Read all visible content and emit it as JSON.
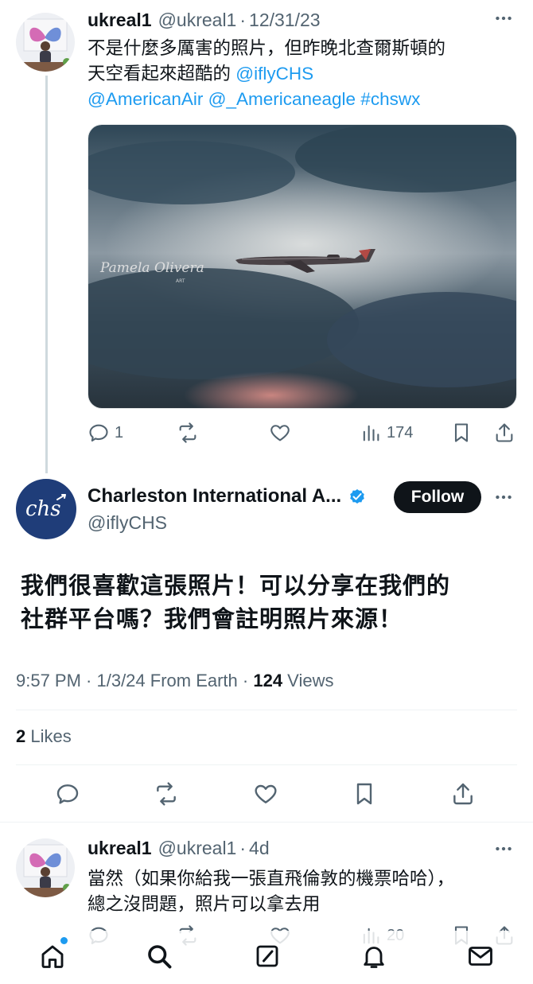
{
  "tweet1": {
    "name": "ukreal1",
    "handle": "@ukreal1",
    "sep": "·",
    "date": "12/31/23",
    "text_line1": "不是什麼多厲害的照片，但昨晚北查爾斯頓的",
    "text_line2_prefix": "天空看起來超酷的 ",
    "mention1": "@iflyCHS",
    "tags_line": "@AmericanAir @_Americaneagle #chswx",
    "watermark": "Pamela Olivera",
    "watermark_sub": "ART",
    "replies": "1",
    "views": "174"
  },
  "main": {
    "name": "Charleston International A...",
    "handle": "@iflyCHS",
    "follow_label": "Follow",
    "avatar_text": "chs",
    "text_line1": "我們很喜歡這張照片！可以分享在我們的",
    "text_line2": "社群平台嗎？我們會註明照片來源！",
    "time_date": "9:57 PM · 1/3/24 From Earth · ",
    "views_count": "124",
    "views_label": " Views",
    "likes_count": "2",
    "likes_label": " Likes"
  },
  "reply": {
    "name": "ukreal1",
    "handle": "@ukreal1",
    "sep": "·",
    "date": "4d",
    "text_line1": "當然（如果你給我一張直飛倫敦的機票哈哈），",
    "text_line2": "總之沒問題，照片可以拿去用",
    "views": "20"
  },
  "colors": {
    "link": "#1d9bf0",
    "muted": "#536471",
    "verified": "#1d9bf0",
    "chs_navy": "#1f3d79"
  }
}
